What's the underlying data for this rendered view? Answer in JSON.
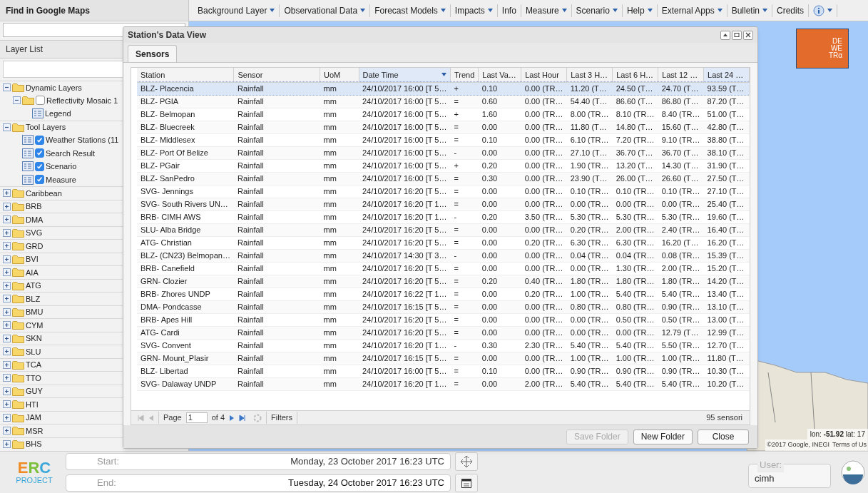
{
  "search_panel": {
    "title": "Find in Google Maps"
  },
  "layer_list": {
    "title": "Layer List",
    "tree": [
      {
        "label": "Dynamic Layers",
        "kind": "folder",
        "expanded": true,
        "children": [
          {
            "label": "Reflectivity Mosaic 1",
            "kind": "folder",
            "expanded": true,
            "checked": false,
            "children": [
              {
                "label": "Legend",
                "kind": "layer"
              }
            ]
          }
        ]
      },
      {
        "label": "Tool Layers",
        "kind": "folder",
        "expanded": true,
        "children": [
          {
            "label": "Weather Stations (11",
            "kind": "layer",
            "checked": true
          },
          {
            "label": "Search Result",
            "kind": "layer",
            "checked": true
          },
          {
            "label": "Scenario",
            "kind": "layer",
            "checked": true
          },
          {
            "label": "Measure",
            "kind": "layer",
            "checked": true
          }
        ]
      },
      {
        "label": "Caribbean",
        "kind": "folder",
        "expanded": false
      },
      {
        "label": "BRB",
        "kind": "folder",
        "expanded": false
      },
      {
        "label": "DMA",
        "kind": "folder",
        "expanded": false
      },
      {
        "label": "SVG",
        "kind": "folder",
        "expanded": false
      },
      {
        "label": "GRD",
        "kind": "folder",
        "expanded": false
      },
      {
        "label": "BVI",
        "kind": "folder",
        "expanded": false
      },
      {
        "label": "AIA",
        "kind": "folder",
        "expanded": false
      },
      {
        "label": "ATG",
        "kind": "folder",
        "expanded": false
      },
      {
        "label": "BLZ",
        "kind": "folder",
        "expanded": false
      },
      {
        "label": "BMU",
        "kind": "folder",
        "expanded": false
      },
      {
        "label": "CYM",
        "kind": "folder",
        "expanded": false
      },
      {
        "label": "SKN",
        "kind": "folder",
        "expanded": false
      },
      {
        "label": "SLU",
        "kind": "folder",
        "expanded": false
      },
      {
        "label": "TCA",
        "kind": "folder",
        "expanded": false
      },
      {
        "label": "TTO",
        "kind": "folder",
        "expanded": false
      },
      {
        "label": "GUY",
        "kind": "folder",
        "expanded": false
      },
      {
        "label": "HTI",
        "kind": "folder",
        "expanded": false
      },
      {
        "label": "JAM",
        "kind": "folder",
        "expanded": false
      },
      {
        "label": "MSR",
        "kind": "folder",
        "expanded": false
      },
      {
        "label": "BHS",
        "kind": "folder",
        "expanded": false
      }
    ]
  },
  "toolbar": [
    {
      "kind": "text",
      "label": "Background Layer",
      "dropdown": true
    },
    {
      "kind": "text",
      "label": "Observational Data",
      "dropdown": true
    },
    {
      "kind": "text",
      "label": "Forecast Models",
      "dropdown": true
    },
    {
      "kind": "text",
      "label": "Impacts",
      "dropdown": true
    },
    {
      "kind": "text",
      "label": "Info",
      "dropdown": false
    },
    {
      "kind": "text",
      "label": "Measure",
      "dropdown": true
    },
    {
      "kind": "text",
      "label": "Scenario",
      "dropdown": true
    },
    {
      "kind": "text",
      "label": "Help",
      "dropdown": true
    },
    {
      "kind": "text",
      "label": "External Apps",
      "dropdown": true
    },
    {
      "kind": "text",
      "label": "Bulletin",
      "dropdown": true
    },
    {
      "kind": "text",
      "label": "Credits",
      "dropdown": false
    },
    {
      "kind": "icon",
      "dropdown": true
    }
  ],
  "map": {
    "logo_lines": [
      "DE",
      "WE",
      "TRα"
    ],
    "coordinates": "lon: **-51.92** lat: 17",
    "attribution": "©2017 Google, INEGI",
    "terms": "Terms of Us"
  },
  "dialog": {
    "title": "Station's Data View",
    "tabs": [
      {
        "label": "Sensors",
        "selected": true
      }
    ],
    "columns": [
      {
        "label": "Station",
        "highlighted": false,
        "menu": false
      },
      {
        "label": "Sensor",
        "highlighted": false,
        "menu": false
      },
      {
        "label": "UoM",
        "highlighted": false,
        "menu": false
      },
      {
        "label": "Date Time",
        "highlighted": true,
        "menu": true
      },
      {
        "label": "Trend",
        "highlighted": false,
        "menu": false
      },
      {
        "label": "Last Va…",
        "highlighted": false,
        "menu": false
      },
      {
        "label": "Last Hour",
        "highlighted": false,
        "menu": false
      },
      {
        "label": "Last 3 H…",
        "highlighted": false,
        "menu": false
      },
      {
        "label": "Last 6 H…",
        "highlighted": false,
        "menu": false
      },
      {
        "label": "Last 12 …",
        "highlighted": false,
        "menu": false
      },
      {
        "label": "Last 24 …",
        "highlighted": true,
        "menu": false
      }
    ],
    "rows": [
      {
        "selected": true,
        "cells": [
          "BLZ- Placencia",
          "Rainfall",
          "mm",
          "24/10/2017 16:00 [T 5…",
          "+",
          "0.10",
          "0.00 (TR…",
          "11.20 (T…",
          "24.50 (T…",
          "24.70 (T…",
          "93.59 (T…"
        ]
      },
      {
        "selected": false,
        "cells": [
          "BLZ- PGIA",
          "Rainfall",
          "mm",
          "24/10/2017 16:00 [T 5…",
          "=",
          "0.60",
          "0.00 (TR…",
          "54.40 (T…",
          "86.60 (T…",
          "86.80 (T…",
          "87.20 (T…"
        ]
      },
      {
        "selected": false,
        "cells": [
          "BLZ- Belmopan",
          "Rainfall",
          "mm",
          "24/10/2017 16:00 [T 5…",
          "+",
          "1.60",
          "0.00 (TR…",
          "8.00 (TR…",
          "8.10 (TR…",
          "8.40 (TR…",
          "51.00 (T…"
        ]
      },
      {
        "selected": false,
        "cells": [
          "BLZ- Bluecreek",
          "Rainfall",
          "mm",
          "24/10/2017 16:00 [T 5…",
          "=",
          "0.00",
          "0.00 (TR…",
          "11.80 (T…",
          "14.80 (T…",
          "15.60 (T…",
          "42.80 (T…"
        ]
      },
      {
        "selected": false,
        "cells": [
          "BLZ- Middlesex",
          "Rainfall",
          "mm",
          "24/10/2017 16:00 [T 5…",
          "=",
          "0.10",
          "0.00 (TR…",
          "6.10 (TR…",
          "7.20 (TR…",
          "9.10 (TR…",
          "38.80 (T…"
        ]
      },
      {
        "selected": false,
        "cells": [
          "BLZ- Port Of Belize",
          "Rainfall",
          "mm",
          "24/10/2017 16:00 [T 5…",
          "-",
          "0.00",
          "0.00 (TR…",
          "27.10 (T…",
          "36.70 (T…",
          "36.70 (T…",
          "38.10 (T…"
        ]
      },
      {
        "selected": false,
        "cells": [
          "BLZ- PGair",
          "Rainfall",
          "mm",
          "24/10/2017 16:00 [T 5…",
          "+",
          "0.20",
          "0.00 (TR…",
          "1.90 (TR…",
          "13.20 (T…",
          "14.30 (T…",
          "31.90 (T…"
        ]
      },
      {
        "selected": false,
        "cells": [
          "BLZ- SanPedro",
          "Rainfall",
          "mm",
          "24/10/2017 16:00 [T 5…",
          "=",
          "0.30",
          "0.00 (TR…",
          "23.90 (T…",
          "26.00 (T…",
          "26.60 (T…",
          "27.50 (T…"
        ]
      },
      {
        "selected": false,
        "cells": [
          "SVG- Jennings",
          "Rainfall",
          "mm",
          "24/10/2017 16:20 [T 5…",
          "=",
          "0.00",
          "0.00 (TR…",
          "0.10 (TR…",
          "0.10 (TR…",
          "0.10 (TR…",
          "27.10 (T…"
        ]
      },
      {
        "selected": false,
        "cells": [
          "SVG- South Rivers UN…",
          "Rainfall",
          "mm",
          "24/10/2017 16:20 [T 1…",
          "=",
          "0.00",
          "0.00 (TR…",
          "0.00 (TR…",
          "0.00 (TR…",
          "0.00 (TR…",
          "25.40 (T…"
        ]
      },
      {
        "selected": false,
        "cells": [
          "BRB- CIMH AWS",
          "Rainfall",
          "mm",
          "24/10/2017 16:20 [T 1…",
          "-",
          "0.20",
          "3.50 (TR…",
          "5.30 (TR…",
          "5.30 (TR…",
          "5.30 (TR…",
          "19.60 (T…"
        ]
      },
      {
        "selected": false,
        "cells": [
          "SLU- Alba Bridge",
          "Rainfall",
          "mm",
          "24/10/2017 16:20 [T 5…",
          "=",
          "0.00",
          "0.00 (TR…",
          "0.20 (TR…",
          "2.00 (TR…",
          "2.40 (TR…",
          "16.40 (T…"
        ]
      },
      {
        "selected": false,
        "cells": [
          "ATG- Christian",
          "Rainfall",
          "mm",
          "24/10/2017 16:20 [T 5…",
          "=",
          "0.00",
          "0.20 (TR…",
          "6.30 (TR…",
          "6.30 (TR…",
          "16.20 (T…",
          "16.20 (T…"
        ]
      },
      {
        "selected": false,
        "cells": [
          "BLZ- (CN23) Belmopan…",
          "Rainfall",
          "mm",
          "24/10/2017 14:30 [T 3…",
          "-",
          "0.00",
          "0.00 (TR…",
          "0.04 (TR…",
          "0.04 (TR…",
          "0.08 (TR…",
          "15.39 (T…"
        ]
      },
      {
        "selected": false,
        "cells": [
          "BRB- Canefield",
          "Rainfall",
          "mm",
          "24/10/2017 16:20 [T 5…",
          "=",
          "0.00",
          "0.00 (TR…",
          "0.00 (TR…",
          "1.30 (TR…",
          "2.00 (TR…",
          "15.20 (T…"
        ]
      },
      {
        "selected": false,
        "cells": [
          "GRN- Clozier",
          "Rainfall",
          "mm",
          "24/10/2017 16:20 [T 5…",
          "=",
          "0.20",
          "0.40 (TR…",
          "1.80 (TR…",
          "1.80 (TR…",
          "1.80 (TR…",
          "14.20 (T…"
        ]
      },
      {
        "selected": false,
        "cells": [
          "BRB- Zhores UNDP",
          "Rainfall",
          "mm",
          "24/10/2017 16:22 [T 1…",
          "=",
          "0.00",
          "0.20 (TR…",
          "1.00 (TR…",
          "5.40 (TR…",
          "5.40 (TR…",
          "13.40 (T…"
        ]
      },
      {
        "selected": false,
        "cells": [
          "DMA- Pondcasse",
          "Rainfall",
          "mm",
          "24/10/2017 16:15 [T 5…",
          "=",
          "0.00",
          "0.00 (TR…",
          "0.80 (TR…",
          "0.80 (TR…",
          "0.90 (TR…",
          "13.10 (T…"
        ]
      },
      {
        "selected": false,
        "cells": [
          "BRB- Apes Hill",
          "Rainfall",
          "mm",
          "24/10/2017 16:20 [T 5…",
          "=",
          "0.00",
          "0.00 (TR…",
          "0.00 (TR…",
          "0.50 (TR…",
          "0.50 (TR…",
          "13.00 (T…"
        ]
      },
      {
        "selected": false,
        "cells": [
          "ATG- Cardi",
          "Rainfall",
          "mm",
          "24/10/2017 16:20 [T 5…",
          "=",
          "0.00",
          "0.00 (TR…",
          "0.00 (TR…",
          "0.00 (TR…",
          "12.79 (T…",
          "12.99 (T…"
        ]
      },
      {
        "selected": false,
        "cells": [
          "SVG- Convent",
          "Rainfall",
          "mm",
          "24/10/2017 16:20 [T 1…",
          "-",
          "0.30",
          "2.30 (TR…",
          "5.40 (TR…",
          "5.40 (TR…",
          "5.50 (TR…",
          "12.70 (T…"
        ]
      },
      {
        "selected": false,
        "cells": [
          "GRN- Mount_Plasir",
          "Rainfall",
          "mm",
          "24/10/2017 16:15 [T 5…",
          "=",
          "0.00",
          "0.00 (TR…",
          "1.00 (TR…",
          "1.00 (TR…",
          "1.00 (TR…",
          "11.80 (T…"
        ]
      },
      {
        "selected": false,
        "cells": [
          "BLZ- Libertad",
          "Rainfall",
          "mm",
          "24/10/2017 16:00 [T 5…",
          "=",
          "0.10",
          "0.00 (TR…",
          "0.90 (TR…",
          "0.90 (TR…",
          "0.90 (TR…",
          "10.30 (T…"
        ]
      },
      {
        "selected": false,
        "cells": [
          "SVG- Dalaway UNDP",
          "Rainfall",
          "mm",
          "24/10/2017 16:20 [T 1…",
          "=",
          "0.00",
          "2.00 (TR…",
          "5.40 (TR…",
          "5.40 (TR…",
          "5.40 (TR…",
          "10.20 (T…"
        ]
      }
    ],
    "paging": {
      "page_label": "Page",
      "page": "1",
      "of": "of 4",
      "filters": "Filters",
      "count": "95 sensori"
    },
    "buttons": [
      {
        "label": "Save Folder",
        "disabled": true
      },
      {
        "label": "New Folder",
        "disabled": false
      },
      {
        "label": "Close",
        "disabled": false
      }
    ]
  },
  "bottom_bar": {
    "logo_letters": [
      "E",
      "R",
      "C"
    ],
    "logo_caption": "PROJECT",
    "start_label": "Start:",
    "start_value": "Monday, 23 October 2017 16:23 UTC",
    "end_label": "End:",
    "end_value": "Tuesday, 24 October 2017 16:23 UTC",
    "user_label": "User:",
    "user_value": "cimh"
  }
}
